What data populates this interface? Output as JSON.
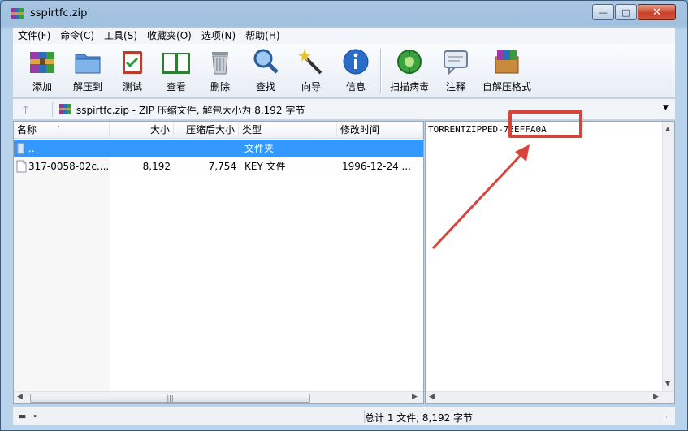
{
  "window": {
    "title": "sspirtfc.zip",
    "controls": {
      "minimize": "—",
      "maximize": "□",
      "close": "✕"
    }
  },
  "menu": [
    "文件(F)",
    "命令(C)",
    "工具(S)",
    "收藏夹(O)",
    "选项(N)",
    "帮助(H)"
  ],
  "toolbar": [
    {
      "label": "添加",
      "icon": "archive-add-icon"
    },
    {
      "label": "解压到",
      "icon": "extract-folder-icon"
    },
    {
      "label": "测试",
      "icon": "test-clipboard-icon"
    },
    {
      "label": "查看",
      "icon": "view-book-icon"
    },
    {
      "label": "删除",
      "icon": "delete-trash-icon"
    },
    {
      "label": "查找",
      "icon": "find-magnifier-icon"
    },
    {
      "label": "向导",
      "icon": "wizard-wand-icon"
    },
    {
      "label": "信息",
      "icon": "info-icon"
    },
    {
      "label": "扫描病毒",
      "icon": "virus-scan-icon"
    },
    {
      "label": "注释",
      "icon": "comment-icon"
    },
    {
      "label": "自解压格式",
      "icon": "sfx-box-icon"
    }
  ],
  "address": {
    "up": "🡑",
    "text": "sspirtfc.zip - ZIP 压缩文件, 解包大小为 8,192 字节",
    "dropdown": "▼"
  },
  "columns": {
    "name": "名称",
    "size": "大小",
    "packed": "压缩后大小",
    "type": "类型",
    "mtime": "修改时间"
  },
  "files": [
    {
      "name": "..",
      "size": "",
      "packed": "",
      "type": "文件夹",
      "mtime": "",
      "selected": true,
      "icon": "folder-up-icon"
    },
    {
      "name": "317-0058-02c....",
      "size": "8,192",
      "packed": "7,754",
      "type": "KEY 文件",
      "mtime": "1996-12-24 ...",
      "selected": false,
      "icon": "file-icon"
    }
  ],
  "comment": {
    "text": "TORRENTZIPPED-75EFFA0A"
  },
  "scroll": {
    "left": "◀",
    "right": "▶",
    "up": "▲",
    "down": "▼",
    "grip": "|||"
  },
  "status": {
    "text": "总计 1 文件, 8,192 字节",
    "icons": "▬ ⊸",
    "grip": "⋰"
  },
  "colors": {
    "highlight": "#d6443a",
    "selection": "#3399ff"
  }
}
